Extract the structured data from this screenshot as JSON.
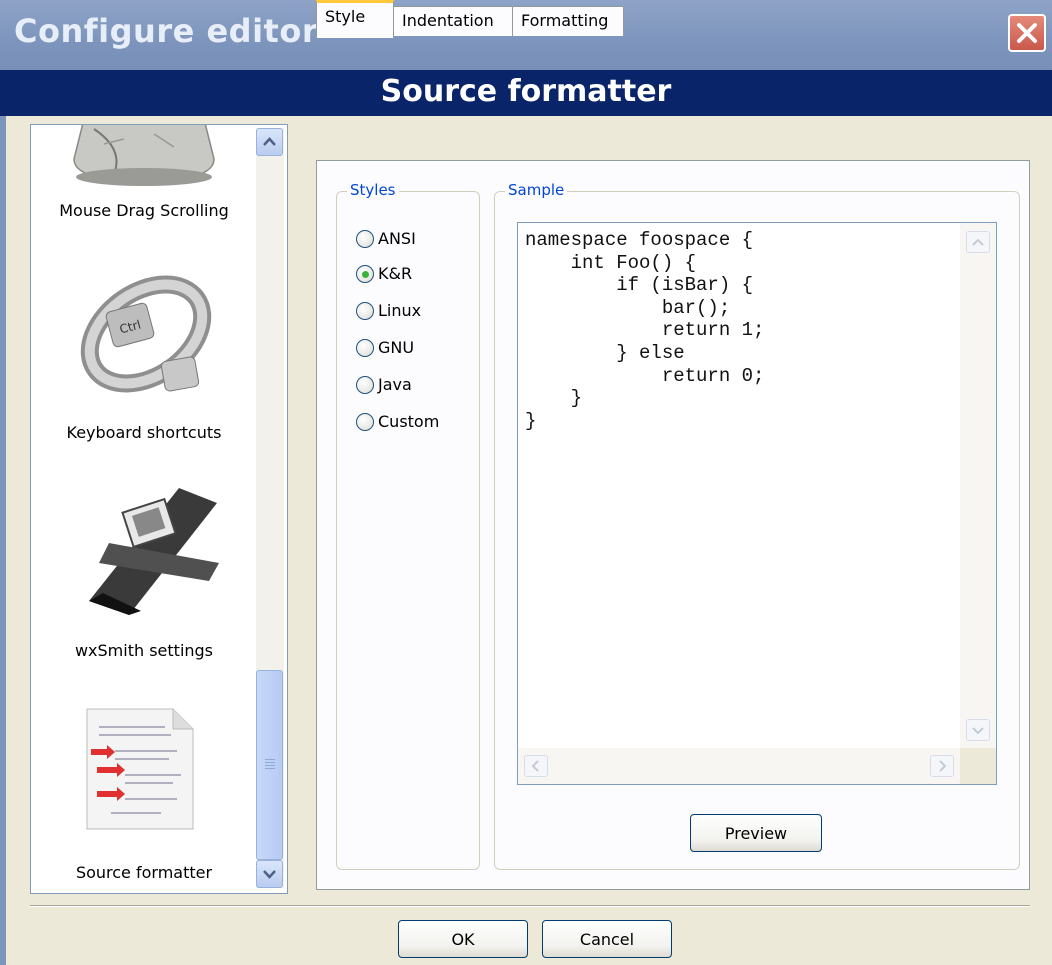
{
  "window": {
    "title": "Configure editor",
    "header": "Source formatter"
  },
  "sidebar": {
    "items": [
      {
        "label": "Mouse Drag Scrolling",
        "icon": "mouse-drag-icon"
      },
      {
        "label": "Keyboard shortcuts",
        "icon": "keyboard-ring-icon"
      },
      {
        "label": "wxSmith settings",
        "icon": "wxsmith-icon"
      },
      {
        "label": "Source formatter",
        "icon": "source-formatter-icon"
      }
    ]
  },
  "tabs": [
    {
      "label": "Style",
      "active": true
    },
    {
      "label": "Indentation",
      "active": false
    },
    {
      "label": "Formatting",
      "active": false
    }
  ],
  "styles_group": {
    "title": "Styles",
    "options": [
      {
        "label": "ANSI",
        "selected": false
      },
      {
        "label": "K&R",
        "selected": true
      },
      {
        "label": "Linux",
        "selected": false
      },
      {
        "label": "GNU",
        "selected": false
      },
      {
        "label": "Java",
        "selected": false
      },
      {
        "label": "Custom",
        "selected": false
      }
    ]
  },
  "sample_group": {
    "title": "Sample",
    "code": "namespace foospace {\n    int Foo() {\n        if (isBar) {\n            bar();\n            return 1;\n        } else\n            return 0;\n    }\n}"
  },
  "buttons": {
    "preview": "Preview",
    "ok": "OK",
    "cancel": "Cancel"
  },
  "colors": {
    "title_bar": "#7d95bd",
    "header_bar": "#0a246a",
    "group_title": "#0046d5",
    "active_tab_accent": "#ffc83c"
  }
}
